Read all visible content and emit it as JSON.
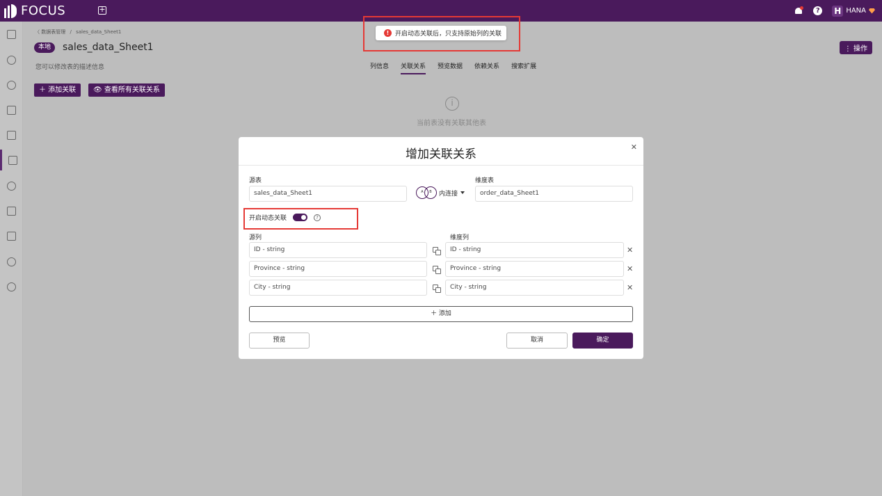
{
  "app": {
    "logo": "FOCUS"
  },
  "topbar": {
    "user_initial": "H",
    "user_name": "HANA"
  },
  "rail": {
    "icons": [
      "home-icon",
      "robot-icon",
      "search-icon",
      "chart-icon",
      "monitor-icon",
      "table-icon",
      "clock-icon",
      "folder-icon",
      "clipboard-icon",
      "database-icon",
      "gear-icon"
    ]
  },
  "breadcrumb": {
    "back": "〈 数据表管理",
    "sep": "/",
    "current": "sales_data_Sheet1"
  },
  "page": {
    "tag": "本地",
    "title": "sales_data_Sheet1",
    "desc": "您可以修改表的描述信息",
    "ops": "⋮ 操作",
    "tabs": [
      "列信息",
      "关联关系",
      "预览数据",
      "依赖关系",
      "搜索扩展"
    ],
    "active_tab": "关联关系",
    "add_relation": "＋ 添加关联",
    "view_all": "👁 查看所有关联关系",
    "empty_text": "当前表没有关联其他表"
  },
  "toast": {
    "message": "开启动态关联后，只支持原始列的关联"
  },
  "modal": {
    "title": "增加关联关系",
    "source_table_label": "源表",
    "source_table": "sales_data_Sheet1",
    "join_type": "内连接",
    "venn_a": "A",
    "venn_b": "B",
    "dim_table_label": "维度表",
    "dim_table": "order_data_Sheet1",
    "dynamic_label": "开启动态关联",
    "source_col_label": "源列",
    "dim_col_label": "维度列",
    "rows": [
      {
        "source": "ID - string",
        "dim": "ID - string"
      },
      {
        "source": "Province - string",
        "dim": "Province - string"
      },
      {
        "source": "City - string",
        "dim": "City - string"
      }
    ],
    "add": "＋ 添加",
    "preview": "预览",
    "cancel": "取消",
    "confirm": "确定"
  }
}
